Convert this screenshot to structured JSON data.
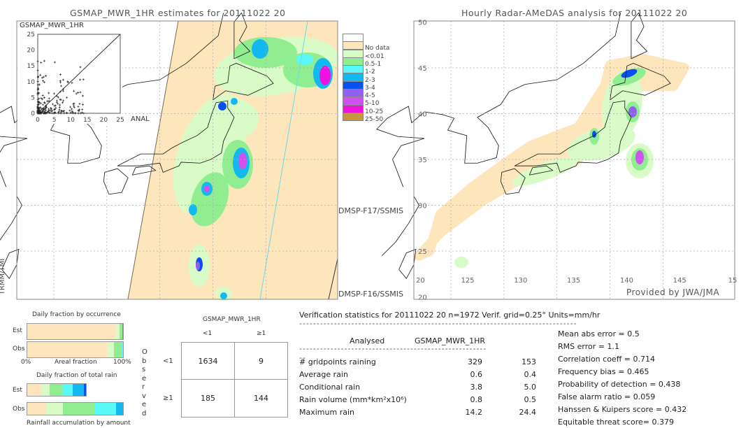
{
  "left_panel": {
    "title": "GSMAP_MWR_1HR estimates for 20111022 20",
    "scatter": {
      "ylabel": "GSMAP_MWR_1HR",
      "xlabel": "ANAL",
      "ticks": [
        "0",
        "5",
        "10",
        "15",
        "20",
        "25"
      ]
    },
    "swath_labels": [
      "DMSP-F17/SSMIS",
      "DMSP-F16/SSMIS",
      "TRMM/TMI"
    ]
  },
  "legend": {
    "items": [
      {
        "label": "",
        "color": "#ffffff"
      },
      {
        "label": "No data",
        "color": "#fde6bc"
      },
      {
        "label": "<0.01",
        "color": "#d8fbc8"
      },
      {
        "label": "0.5-1",
        "color": "#90ee90"
      },
      {
        "label": "1-2",
        "color": "#5af8f8"
      },
      {
        "label": "2-3",
        "color": "#14b8f0"
      },
      {
        "label": "3-4",
        "color": "#0a50f0"
      },
      {
        "label": "4-5",
        "color": "#9060f0"
      },
      {
        "label": "5-10",
        "color": "#d050f0"
      },
      {
        "label": "10-25",
        "color": "#f010e0"
      },
      {
        "label": "25-50",
        "color": "#c8963c"
      }
    ]
  },
  "right_panel": {
    "title": "Hourly Radar-AMeDAS analysis for 20111022 20",
    "lat_labels": [
      "50",
      "45",
      "40",
      "35",
      "30",
      "25",
      "20"
    ],
    "lon_labels": [
      "20",
      "125",
      "130",
      "135",
      "140",
      "145",
      "15"
    ],
    "credit": "Provided by JWA/JMA"
  },
  "occurrence": {
    "title": "Daily fraction by occurrence",
    "est_label": "Est",
    "obs_label": "Obs",
    "axis": [
      "0%",
      "Areal fraction",
      "100%"
    ],
    "est": [
      92,
      4.5,
      2.5,
      0.6,
      0.4
    ],
    "obs": [
      83,
      7.5,
      8,
      1.5
    ]
  },
  "total_rain": {
    "title": "Daily fraction of total rain",
    "est_label": "Est",
    "obs_label": "Obs",
    "footer": "Rainfall accumulation by amount",
    "est": [
      15,
      8,
      13,
      11,
      12,
      2
    ],
    "obs": [
      20,
      17,
      33,
      23,
      7
    ]
  },
  "contingency": {
    "header": "GSMAP_MWR_1HR",
    "col_labels": [
      "<1",
      "≥1"
    ],
    "row_labels": [
      "<1",
      "≥1"
    ],
    "side_label": "Observed",
    "cells": [
      [
        "1634",
        "9"
      ],
      [
        "185",
        "144"
      ]
    ]
  },
  "stats": {
    "header": "Verification statistics for 20111022 20   n=1972   Verif. grid=0.25°   Units=mm/hr",
    "col_analysed": "Analysed",
    "col_model": "GSMAP_MWR_1HR",
    "rows": [
      {
        "label": "# gridpoints raining",
        "a": "329",
        "b": "153"
      },
      {
        "label": "Average rain",
        "a": "0.6",
        "b": "0.4"
      },
      {
        "label": "Conditional rain",
        "a": "3.8",
        "b": "5.0"
      },
      {
        "label": "Rain volume (mm*km²x10⁶)",
        "a": "0.8",
        "b": "0.5"
      },
      {
        "label": "Maximum rain",
        "a": "14.2",
        "b": "24.4"
      }
    ],
    "scores": [
      "Mean abs error = 0.5",
      "RMS error = 1.1",
      "Correlation coeff = 0.714",
      "Frequency bias = 0.465",
      "Probability of detection = 0.438",
      "False alarm ratio = 0.059",
      "Hanssen & Kuipers score = 0.432",
      "Equitable threat score= 0.379"
    ]
  }
}
